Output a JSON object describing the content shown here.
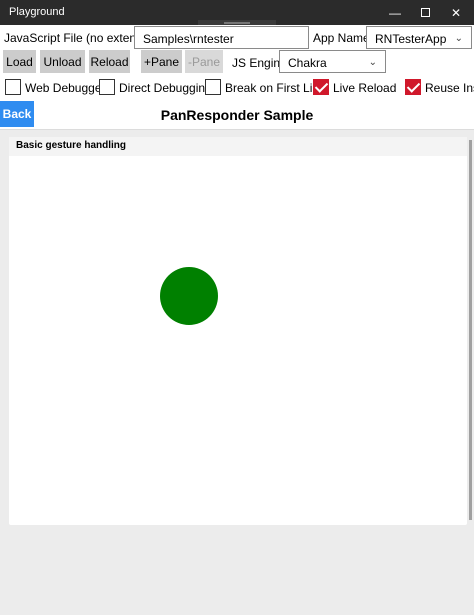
{
  "window": {
    "title": "Playground"
  },
  "toolbar": {
    "js_file_label": "JavaScript File (no extension):",
    "js_file_value": "Samples\\rntester",
    "app_name_label": "App Name:",
    "app_name_value": "RNTesterApp",
    "buttons": {
      "load": "Load",
      "unload": "Unload",
      "reload": "Reload",
      "add_pane": "+Pane",
      "remove_pane": "-Pane"
    },
    "js_engine_label": "JS Engine:",
    "js_engine_value": "Chakra",
    "checkboxes": {
      "web_debugger": "Web Debugger",
      "direct_debugging": "Direct Debugging",
      "break_first_line": "Break on First Line",
      "live_reload": "Live Reload",
      "reuse_instance": "Reuse Insta"
    },
    "checked": {
      "web_debugger": false,
      "direct_debugging": false,
      "break_first_line": false,
      "live_reload": true,
      "reuse_instance": true
    }
  },
  "appbar": {
    "back_label": "Back",
    "title": "PanResponder Sample"
  },
  "content": {
    "section_title": "Basic gesture handling"
  },
  "colors": {
    "accent_blue": "#2f8cf0",
    "checkbox_red": "#d0182b",
    "circle_green": "#008000"
  }
}
